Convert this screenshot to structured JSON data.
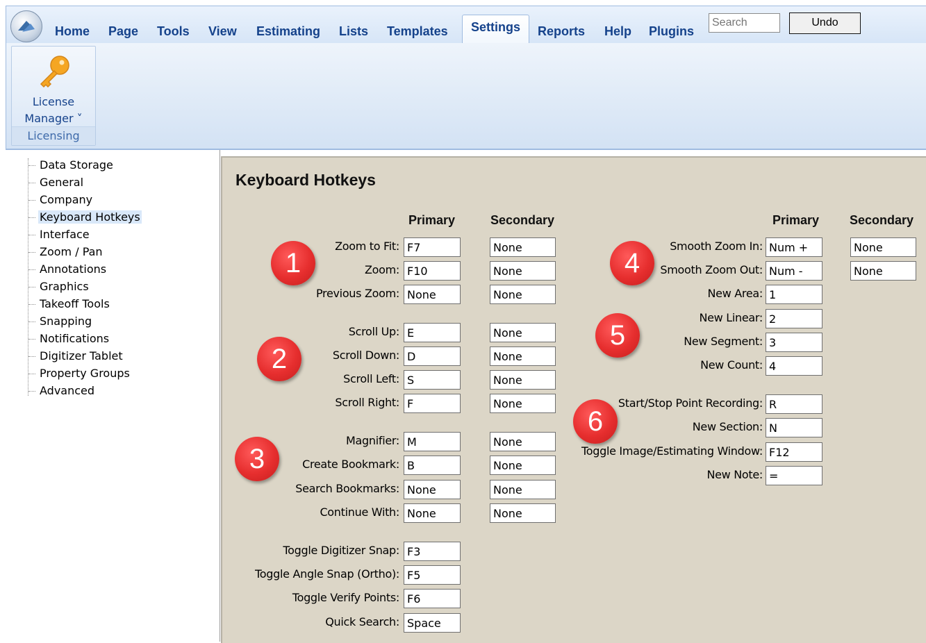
{
  "ribbon": {
    "tabs": [
      {
        "label": "Home"
      },
      {
        "label": "Page"
      },
      {
        "label": "Tools"
      },
      {
        "label": "View"
      },
      {
        "label": "Estimating"
      },
      {
        "label": "Lists"
      },
      {
        "label": "Templates"
      },
      {
        "label": "Settings",
        "active": true
      },
      {
        "label": "Reports"
      },
      {
        "label": "Help"
      },
      {
        "label": "Plugins"
      }
    ],
    "search_placeholder": "Search",
    "undo_label": "Undo",
    "license_manager_line1": "License",
    "license_manager_line2": "Manager ˅",
    "group_label": "Licensing",
    "key_icon": "key-icon"
  },
  "sidebar": {
    "items": [
      {
        "label": "Data Storage"
      },
      {
        "label": "General"
      },
      {
        "label": "Company"
      },
      {
        "label": "Keyboard Hotkeys",
        "selected": true
      },
      {
        "label": "Interface"
      },
      {
        "label": "Zoom / Pan"
      },
      {
        "label": "Annotations"
      },
      {
        "label": "Graphics"
      },
      {
        "label": "Takeoff Tools"
      },
      {
        "label": "Snapping"
      },
      {
        "label": "Notifications"
      },
      {
        "label": "Digitizer Tablet"
      },
      {
        "label": "Property Groups"
      },
      {
        "label": "Advanced"
      }
    ]
  },
  "main": {
    "title": "Keyboard Hotkeys",
    "left_primary_header": "Primary",
    "left_secondary_header": "Secondary",
    "right_primary_header": "Primary",
    "right_secondary_header": "Secondary",
    "left_rows": [
      {
        "label": "Zoom to Fit:",
        "primary": "F7",
        "secondary": "None"
      },
      {
        "label": "Zoom:",
        "primary": "F10",
        "secondary": "None"
      },
      {
        "label": "Previous Zoom:",
        "primary": "None",
        "secondary": "None"
      },
      {
        "label": "Scroll Up:",
        "primary": "E",
        "secondary": "None"
      },
      {
        "label": "Scroll Down:",
        "primary": "D",
        "secondary": "None"
      },
      {
        "label": "Scroll Left:",
        "primary": "S",
        "secondary": "None"
      },
      {
        "label": "Scroll Right:",
        "primary": "F",
        "secondary": "None"
      },
      {
        "label": "Magnifier:",
        "primary": "M",
        "secondary": "None"
      },
      {
        "label": "Create Bookmark:",
        "primary": "B",
        "secondary": "None"
      },
      {
        "label": "Search Bookmarks:",
        "primary": "None",
        "secondary": "None"
      },
      {
        "label": "Continue With:",
        "primary": "None",
        "secondary": "None"
      },
      {
        "label": "Toggle Digitizer Snap:",
        "primary": "F3"
      },
      {
        "label": "Toggle Angle Snap (Ortho):",
        "primary": "F5"
      },
      {
        "label": "Toggle Verify Points:",
        "primary": "F6"
      },
      {
        "label": "Quick Search:",
        "primary": "Space"
      }
    ],
    "right_rows": [
      {
        "label": "Smooth Zoom In:",
        "primary": "Num +",
        "secondary": "None"
      },
      {
        "label": "Smooth Zoom Out:",
        "primary": "Num -",
        "secondary": "None"
      },
      {
        "label": "New Area:",
        "primary": "1"
      },
      {
        "label": "New Linear:",
        "primary": "2"
      },
      {
        "label": "New Segment:",
        "primary": "3"
      },
      {
        "label": "New Count:",
        "primary": "4"
      },
      {
        "label": "Start/Stop Point Recording:",
        "primary": "R"
      },
      {
        "label": "New Section:",
        "primary": "N"
      },
      {
        "label": "Toggle Image/Estimating Window:",
        "primary": "F12"
      },
      {
        "label": "New Note:",
        "primary": "="
      }
    ],
    "badges": [
      "1",
      "2",
      "3",
      "4",
      "5",
      "6"
    ]
  },
  "colors": {
    "accent": "#15428b",
    "badge": "#e62e2e",
    "content_bg": "#dcd6c7"
  }
}
